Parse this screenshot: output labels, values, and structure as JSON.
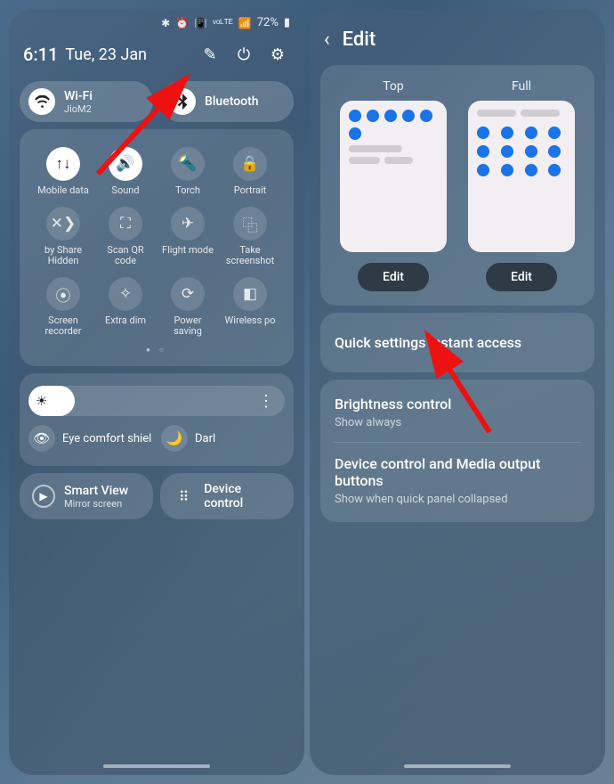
{
  "status": {
    "battery": "72%",
    "bt": "✱",
    "alarm": "⏰",
    "vib": "📳",
    "net": "ᵛᵒᴸᵀᴱ",
    "bars": "📶"
  },
  "header": {
    "time": "6:11",
    "date": "Tue, 23 Jan",
    "edit": "✎",
    "power": "⏻",
    "settings": "⚙"
  },
  "wifi": {
    "title": "Wi-Fi",
    "sub": "JioM2"
  },
  "bt": {
    "title": "Bluetooth"
  },
  "tiles": [
    {
      "name": "mobile-data",
      "icon": "↑↓",
      "label": "Mobile data",
      "on": true
    },
    {
      "name": "sound",
      "icon": "🔊",
      "label": "Sound",
      "on": true
    },
    {
      "name": "torch",
      "icon": "🔦",
      "label": "Torch",
      "on": false
    },
    {
      "name": "portrait",
      "icon": "🔒",
      "label": "Portrait",
      "on": false
    },
    {
      "name": "nearby-share",
      "icon": "✕❯",
      "label": "by Share\nHidden",
      "on": false
    },
    {
      "name": "scan-qr",
      "icon": "⛶",
      "label": "Scan QR code",
      "on": false
    },
    {
      "name": "flight-mode",
      "icon": "✈",
      "label": "Flight mode",
      "on": false
    },
    {
      "name": "screenshot",
      "icon": "⿻",
      "label": "Take screenshot",
      "on": false
    },
    {
      "name": "screen-recorder",
      "icon": "⦿",
      "label": "Screen recorder",
      "on": false
    },
    {
      "name": "extra-dim",
      "icon": "✧",
      "label": "Extra dim",
      "on": false
    },
    {
      "name": "power-saving",
      "icon": "⟳",
      "label": "Power saving",
      "on": false
    },
    {
      "name": "wireless-power",
      "icon": "◧",
      "label": "Wireless po",
      "on": false
    }
  ],
  "eye": "Eye comfort shiel",
  "dark": "Darl",
  "smartview": {
    "title": "Smart View",
    "sub": "Mirror screen"
  },
  "devctrl": "Device control",
  "right": {
    "title": "Edit",
    "top": "Top",
    "full": "Full",
    "editbtn": "Edit",
    "qia": "Quick settings instant access",
    "bc": "Brightness control",
    "bcs": "Show always",
    "dc": "Device control and Media output buttons",
    "dcs": "Show when quick panel collapsed"
  }
}
